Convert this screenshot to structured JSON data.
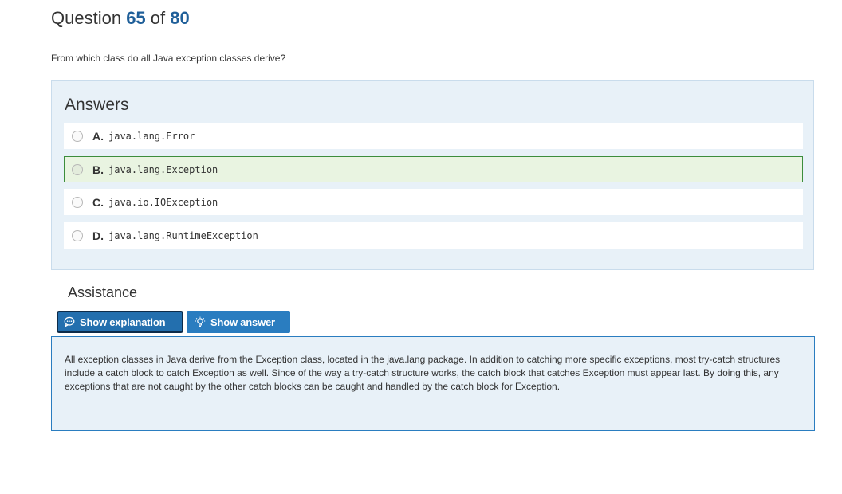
{
  "question": {
    "label": "Question",
    "current": "65",
    "of_label": "of",
    "total": "80",
    "text": "From which class do all Java exception classes derive?"
  },
  "answers": {
    "title": "Answers",
    "items": [
      {
        "letter": "A.",
        "code": "java.lang.Error",
        "correct": false
      },
      {
        "letter": "B.",
        "code": "java.lang.Exception",
        "correct": true
      },
      {
        "letter": "C.",
        "code": "java.io.IOException",
        "correct": false
      },
      {
        "letter": "D.",
        "code": "java.lang.RuntimeException",
        "correct": false
      }
    ]
  },
  "assistance": {
    "title": "Assistance",
    "show_explanation_label": "Show explanation",
    "show_explanation_icon": "speech-bubble-icon",
    "show_answer_label": "Show answer",
    "show_answer_icon": "lightbulb-icon",
    "explanation_text": "All exception classes in Java derive from the Exception class, located in the java.lang package. In addition to catching more specific exceptions, most try-catch structures include a catch block to catch Exception as well. Since of the way a try-catch structure works, the catch block that catches Exception must appear last. By doing this, any exceptions that are not caught by the other catch blocks can be caught and handled by the catch block for Exception."
  },
  "colors": {
    "accent": "#2a7dc0",
    "number": "#1f5f99",
    "panel_bg": "#e8f1f8",
    "correct_border": "#3c8d3c",
    "correct_bg": "#e9f4e1"
  }
}
